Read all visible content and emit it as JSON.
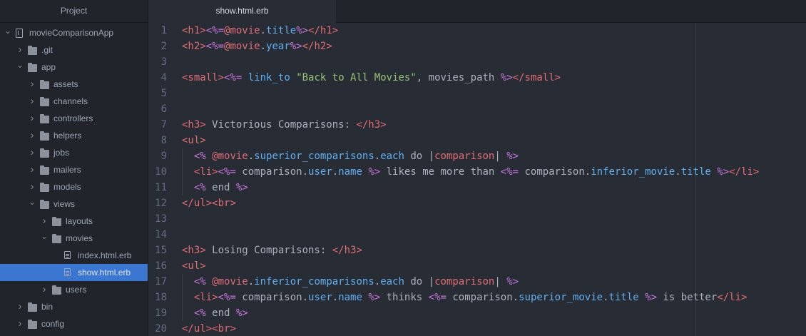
{
  "sidebar": {
    "header": "Project",
    "tree": [
      {
        "label": "movieComparisonApp",
        "type": "repo",
        "depth": 0,
        "expanded": true
      },
      {
        "label": ".git",
        "type": "folder",
        "depth": 1,
        "expanded": false
      },
      {
        "label": "app",
        "type": "folder",
        "depth": 1,
        "expanded": true
      },
      {
        "label": "assets",
        "type": "folder",
        "depth": 2,
        "expanded": false
      },
      {
        "label": "channels",
        "type": "folder",
        "depth": 2,
        "expanded": false
      },
      {
        "label": "controllers",
        "type": "folder",
        "depth": 2,
        "expanded": false
      },
      {
        "label": "helpers",
        "type": "folder",
        "depth": 2,
        "expanded": false
      },
      {
        "label": "jobs",
        "type": "folder",
        "depth": 2,
        "expanded": false
      },
      {
        "label": "mailers",
        "type": "folder",
        "depth": 2,
        "expanded": false
      },
      {
        "label": "models",
        "type": "folder",
        "depth": 2,
        "expanded": false
      },
      {
        "label": "views",
        "type": "folder",
        "depth": 2,
        "expanded": true
      },
      {
        "label": "layouts",
        "type": "folder",
        "depth": 3,
        "expanded": false
      },
      {
        "label": "movies",
        "type": "folder",
        "depth": 3,
        "expanded": true
      },
      {
        "label": "index.html.erb",
        "type": "file",
        "depth": 4
      },
      {
        "label": "show.html.erb",
        "type": "file",
        "depth": 4,
        "selected": true
      },
      {
        "label": "users",
        "type": "folder",
        "depth": 3,
        "expanded": false
      },
      {
        "label": "bin",
        "type": "folder",
        "depth": 1,
        "expanded": false
      },
      {
        "label": "config",
        "type": "folder",
        "depth": 1,
        "expanded": false
      }
    ]
  },
  "tabs": [
    {
      "label": "show.html.erb",
      "active": true
    }
  ],
  "editor": {
    "lines": [
      {
        "n": "1",
        "indent": 0,
        "tokens": [
          [
            "tag",
            "<h1>"
          ],
          [
            "delim",
            "<%="
          ],
          [
            "ivar",
            "@movie"
          ],
          [
            "punc",
            "."
          ],
          [
            "meth",
            "title"
          ],
          [
            "delim",
            "%>"
          ],
          [
            "tag",
            "</h1>"
          ]
        ]
      },
      {
        "n": "2",
        "indent": 0,
        "tokens": [
          [
            "tag",
            "<h2>"
          ],
          [
            "delim",
            "<%="
          ],
          [
            "ivar",
            "@movie"
          ],
          [
            "punc",
            "."
          ],
          [
            "meth",
            "year"
          ],
          [
            "delim",
            "%>"
          ],
          [
            "tag",
            "</h2>"
          ]
        ]
      },
      {
        "n": "3",
        "indent": 0,
        "tokens": []
      },
      {
        "n": "4",
        "indent": 0,
        "tokens": [
          [
            "tag",
            "<small>"
          ],
          [
            "delim",
            "<%="
          ],
          [
            "plain",
            " "
          ],
          [
            "meth",
            "link_to"
          ],
          [
            "plain",
            " "
          ],
          [
            "str",
            "\"Back to All Movies\""
          ],
          [
            "plain",
            ", movies_path "
          ],
          [
            "delim",
            "%>"
          ],
          [
            "tag",
            "</small>"
          ]
        ]
      },
      {
        "n": "5",
        "indent": 0,
        "tokens": []
      },
      {
        "n": "6",
        "indent": 0,
        "tokens": []
      },
      {
        "n": "7",
        "indent": 0,
        "tokens": [
          [
            "tag",
            "<h3>"
          ],
          [
            "plain",
            " Victorious Comparisons: "
          ],
          [
            "tag",
            "</h3>"
          ]
        ]
      },
      {
        "n": "8",
        "indent": 0,
        "tokens": [
          [
            "tag",
            "<ul>"
          ]
        ]
      },
      {
        "n": "9",
        "indent": 1,
        "tokens": [
          [
            "plain",
            "  "
          ],
          [
            "delim",
            "<%"
          ],
          [
            "plain",
            " "
          ],
          [
            "ivar",
            "@movie"
          ],
          [
            "punc",
            "."
          ],
          [
            "meth",
            "superior_comparisons"
          ],
          [
            "punc",
            "."
          ],
          [
            "meth",
            "each"
          ],
          [
            "plain",
            " do |"
          ],
          [
            "ivar",
            "comparison"
          ],
          [
            "plain",
            "| "
          ],
          [
            "delim",
            "%>"
          ]
        ]
      },
      {
        "n": "10",
        "indent": 1,
        "tokens": [
          [
            "plain",
            "  "
          ],
          [
            "tag",
            "<li>"
          ],
          [
            "delim",
            "<%="
          ],
          [
            "plain",
            " comparison."
          ],
          [
            "meth",
            "user"
          ],
          [
            "punc",
            "."
          ],
          [
            "meth",
            "name"
          ],
          [
            "plain",
            " "
          ],
          [
            "delim",
            "%>"
          ],
          [
            "plain",
            " likes me more than "
          ],
          [
            "delim",
            "<%="
          ],
          [
            "plain",
            " comparison."
          ],
          [
            "meth",
            "inferior_movie"
          ],
          [
            "punc",
            "."
          ],
          [
            "meth",
            "title"
          ],
          [
            "plain",
            " "
          ],
          [
            "delim",
            "%>"
          ],
          [
            "tag",
            "</li>"
          ]
        ]
      },
      {
        "n": "11",
        "indent": 1,
        "tokens": [
          [
            "plain",
            "  "
          ],
          [
            "delim",
            "<%"
          ],
          [
            "plain",
            " end "
          ],
          [
            "delim",
            "%>"
          ]
        ]
      },
      {
        "n": "12",
        "indent": 0,
        "tokens": [
          [
            "tag",
            "</ul>"
          ],
          [
            "tag",
            "<br>"
          ]
        ]
      },
      {
        "n": "13",
        "indent": 0,
        "tokens": []
      },
      {
        "n": "14",
        "indent": 0,
        "tokens": []
      },
      {
        "n": "15",
        "indent": 0,
        "tokens": [
          [
            "tag",
            "<h3>"
          ],
          [
            "plain",
            " Losing Comparisons: "
          ],
          [
            "tag",
            "</h3>"
          ]
        ]
      },
      {
        "n": "16",
        "indent": 0,
        "tokens": [
          [
            "tag",
            "<ul>"
          ]
        ]
      },
      {
        "n": "17",
        "indent": 1,
        "tokens": [
          [
            "plain",
            "  "
          ],
          [
            "delim",
            "<%"
          ],
          [
            "plain",
            " "
          ],
          [
            "ivar",
            "@movie"
          ],
          [
            "punc",
            "."
          ],
          [
            "meth",
            "inferior_comparisons"
          ],
          [
            "punc",
            "."
          ],
          [
            "meth",
            "each"
          ],
          [
            "plain",
            " do |"
          ],
          [
            "ivar",
            "comparison"
          ],
          [
            "plain",
            "| "
          ],
          [
            "delim",
            "%>"
          ]
        ]
      },
      {
        "n": "18",
        "indent": 1,
        "tokens": [
          [
            "plain",
            "  "
          ],
          [
            "tag",
            "<li>"
          ],
          [
            "delim",
            "<%="
          ],
          [
            "plain",
            " comparison."
          ],
          [
            "meth",
            "user"
          ],
          [
            "punc",
            "."
          ],
          [
            "meth",
            "name"
          ],
          [
            "plain",
            " "
          ],
          [
            "delim",
            "%>"
          ],
          [
            "plain",
            " thinks "
          ],
          [
            "delim",
            "<%="
          ],
          [
            "plain",
            " comparison."
          ],
          [
            "meth",
            "superior_movie"
          ],
          [
            "punc",
            "."
          ],
          [
            "meth",
            "title"
          ],
          [
            "plain",
            " "
          ],
          [
            "delim",
            "%>"
          ],
          [
            "plain",
            " is better"
          ],
          [
            "tag",
            "</li>"
          ]
        ]
      },
      {
        "n": "19",
        "indent": 1,
        "tokens": [
          [
            "plain",
            "  "
          ],
          [
            "delim",
            "<%"
          ],
          [
            "plain",
            " end "
          ],
          [
            "delim",
            "%>"
          ]
        ]
      },
      {
        "n": "20",
        "indent": 0,
        "tokens": [
          [
            "tag",
            "</ul>"
          ],
          [
            "tag",
            "<br>"
          ]
        ]
      }
    ]
  }
}
